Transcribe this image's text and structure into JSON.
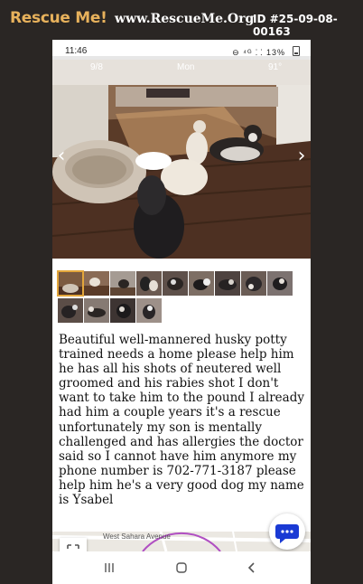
{
  "header": {
    "brand": "Rescue Me!",
    "site": "www.RescueMe.Org",
    "pet_id": "ID #25-09-08-00163"
  },
  "status_bar": {
    "time": "11:46",
    "icons": "⊖ ⁴ᴳ ⸬ 13%"
  },
  "photo": {
    "date": "9/8",
    "day": "Mon",
    "temp": "91°",
    "prev": "‹",
    "next": "›"
  },
  "thumbnails": {
    "count": 13,
    "active_index": 0
  },
  "description": "Beautiful well-mannered husky potty trained needs a home please help him he has all his shots of neutered well groomed and his rabies shot I don't want to take him to the pound I already had him a couple years it's a rescue unfortunately my son is mentally challenged and has allergies the doctor said so I cannot have him anymore my phone number is 702-771-3187 please help him he's a very good dog my name is Ysabel",
  "map": {
    "street": "West Sahara Avenue"
  },
  "colors": {
    "brand": "#e8b25c",
    "chat_icon": "#1a3ad4",
    "active_thumb": "#e3a63b",
    "background": "#2a2624"
  },
  "icons": [
    "chat-bubble-icon",
    "expand-icon",
    "recent-apps-icon",
    "home-icon",
    "back-icon",
    "battery-icon"
  ]
}
